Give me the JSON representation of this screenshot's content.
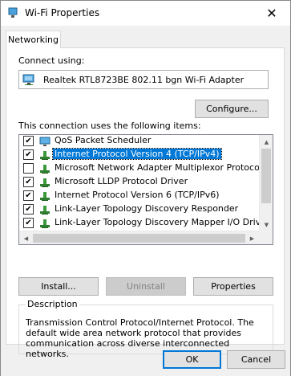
{
  "window": {
    "title": "Wi-Fi Properties",
    "close_glyph": "✕"
  },
  "tabs": [
    {
      "label": "Networking"
    }
  ],
  "connect": {
    "label": "Connect using:",
    "adapter_name": "Realtek RTL8723BE 802.11 bgn Wi-Fi Adapter",
    "configure_label": "Configure..."
  },
  "items_label": "This connection uses the following items:",
  "items": [
    {
      "label": "QoS Packet Scheduler",
      "checked": true,
      "icon": "network-service-icon"
    },
    {
      "label": "Internet Protocol Version 4 (TCP/IPv4)",
      "checked": true,
      "selected": true,
      "icon": "protocol-icon"
    },
    {
      "label": "Microsoft Network Adapter Multiplexor Protocol",
      "checked": false,
      "icon": "protocol-icon"
    },
    {
      "label": "Microsoft LLDP Protocol Driver",
      "checked": true,
      "icon": "protocol-icon"
    },
    {
      "label": "Internet Protocol Version 6 (TCP/IPv6)",
      "checked": true,
      "icon": "protocol-icon"
    },
    {
      "label": "Link-Layer Topology Discovery Responder",
      "checked": true,
      "icon": "protocol-icon"
    },
    {
      "label": "Link-Layer Topology Discovery Mapper I/O Driver",
      "checked": true,
      "icon": "protocol-icon"
    }
  ],
  "actions": {
    "install": "Install...",
    "uninstall": "Uninstall",
    "properties": "Properties"
  },
  "description": {
    "title": "Description",
    "text": "Transmission Control Protocol/Internet Protocol. The default wide area network protocol that provides communication across diverse interconnected networks."
  },
  "footer": {
    "ok": "OK",
    "cancel": "Cancel"
  },
  "colors": {
    "selection": "#0078d7",
    "window_bg": "#f0f0f0",
    "panel_bg": "#ffffff"
  }
}
